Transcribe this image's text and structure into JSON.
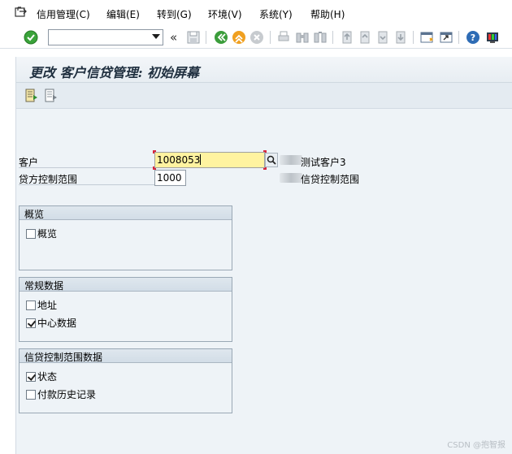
{
  "menubar": {
    "items": [
      {
        "label": "信用管理(C)"
      },
      {
        "label": "编辑(E)"
      },
      {
        "label": "转到(G)"
      },
      {
        "label": "环境(V)"
      },
      {
        "label": "系统(Y)"
      },
      {
        "label": "帮助(H)"
      }
    ]
  },
  "toolbar": {
    "command_field_value": "",
    "chevron": "«"
  },
  "screen": {
    "title": "更改 客户信贷管理: 初始屏幕"
  },
  "fields": {
    "customer": {
      "label": "客户",
      "value": "1008053",
      "description": "测试客户3"
    },
    "credit_area": {
      "label": "贷方控制范围",
      "value": "1000",
      "description": "信贷控制范围"
    }
  },
  "groups": {
    "overview": {
      "title": "概览",
      "items": [
        {
          "label": "概览",
          "checked": false
        }
      ]
    },
    "general": {
      "title": "常规数据",
      "items": [
        {
          "label": "地址",
          "checked": false
        },
        {
          "label": "中心数据",
          "checked": true
        }
      ]
    },
    "credit_area_data": {
      "title": "信贷控制范围数据",
      "items": [
        {
          "label": "状态",
          "checked": true
        },
        {
          "label": "付款历史记录",
          "checked": false
        }
      ]
    }
  },
  "watermark": "CSDN @抱智报",
  "colors": {
    "accent_focus": "#fff3a0",
    "ok_green": "#3aa33a",
    "screen_bg": "#eef3f7"
  }
}
